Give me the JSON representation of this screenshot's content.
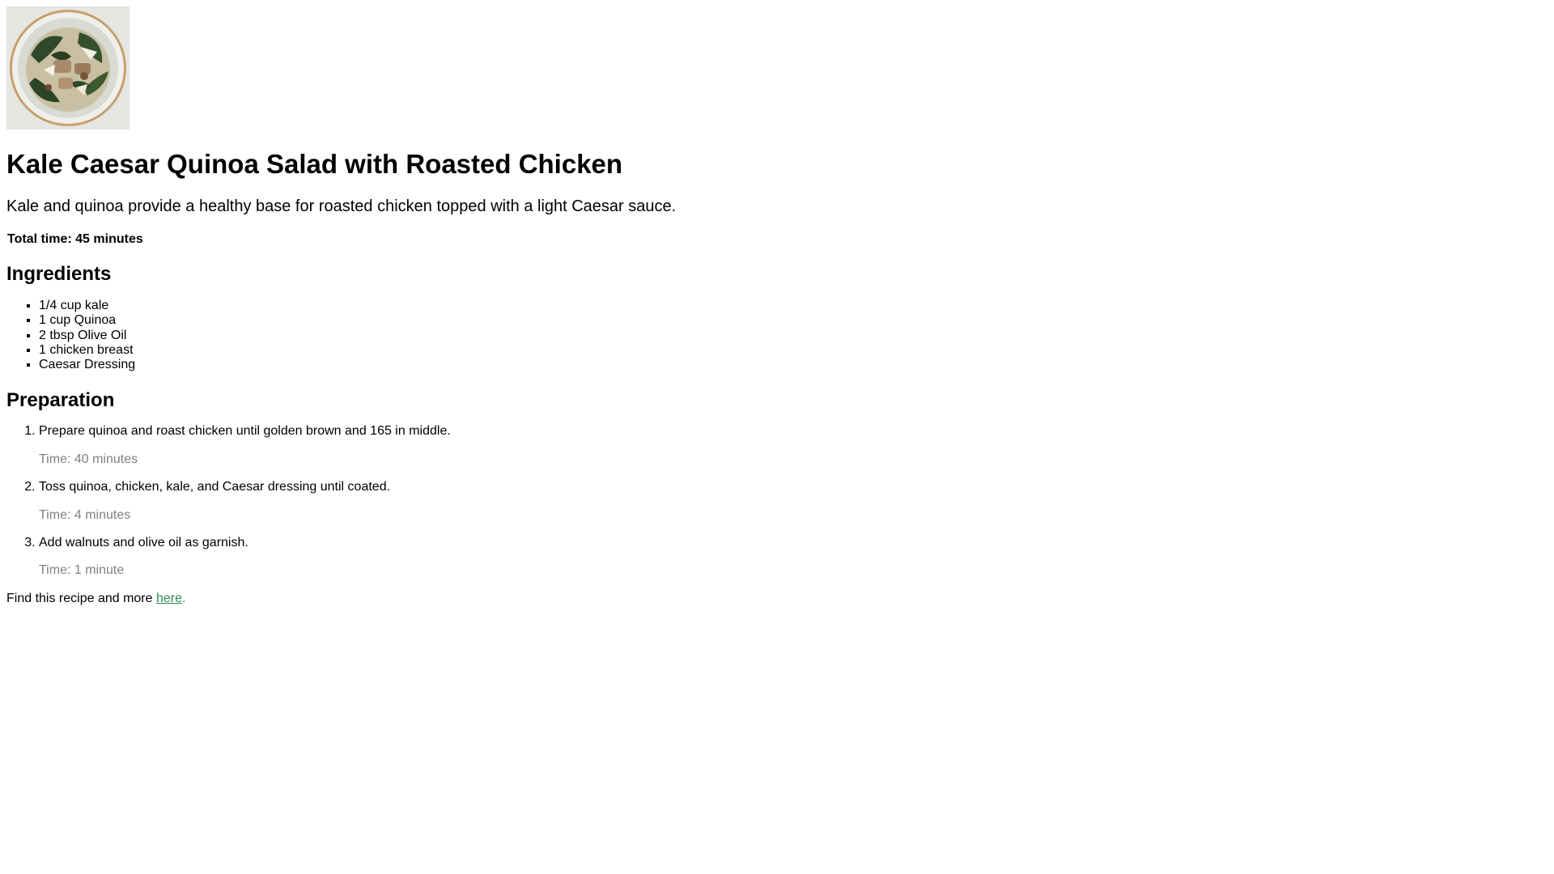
{
  "recipe": {
    "photo_alt": "kale caesar quinoa salad photo",
    "title": "Kale Caesar Quinoa Salad with Roasted Chicken",
    "description": "Kale and quinoa provide a healthy base for roasted chicken topped with a light Caesar sauce.",
    "total_time": "Total time: 45 minutes"
  },
  "ingredients": {
    "heading": "Ingredients",
    "items": [
      "1/4 cup kale",
      "1 cup Quinoa",
      "2 tbsp Olive Oil",
      "1 chicken breast",
      "Caesar Dressing"
    ]
  },
  "preparation": {
    "heading": "Preparation",
    "steps": [
      {
        "text": "Prepare quinoa and roast chicken until golden brown and 165 in middle.",
        "time": "Time: 40 minutes"
      },
      {
        "text": "Toss quinoa, chicken, kale, and Caesar dressing until coated.",
        "time": "Time: 4 minutes"
      },
      {
        "text": "Add walnuts and olive oil as garnish.",
        "time": "Time: 1 minute"
      }
    ]
  },
  "footer": {
    "prefix": "Find this recipe and more ",
    "link_text": "here",
    "suffix": "."
  },
  "colors": {
    "link": "#2e8b57",
    "step_time": "#808080"
  }
}
